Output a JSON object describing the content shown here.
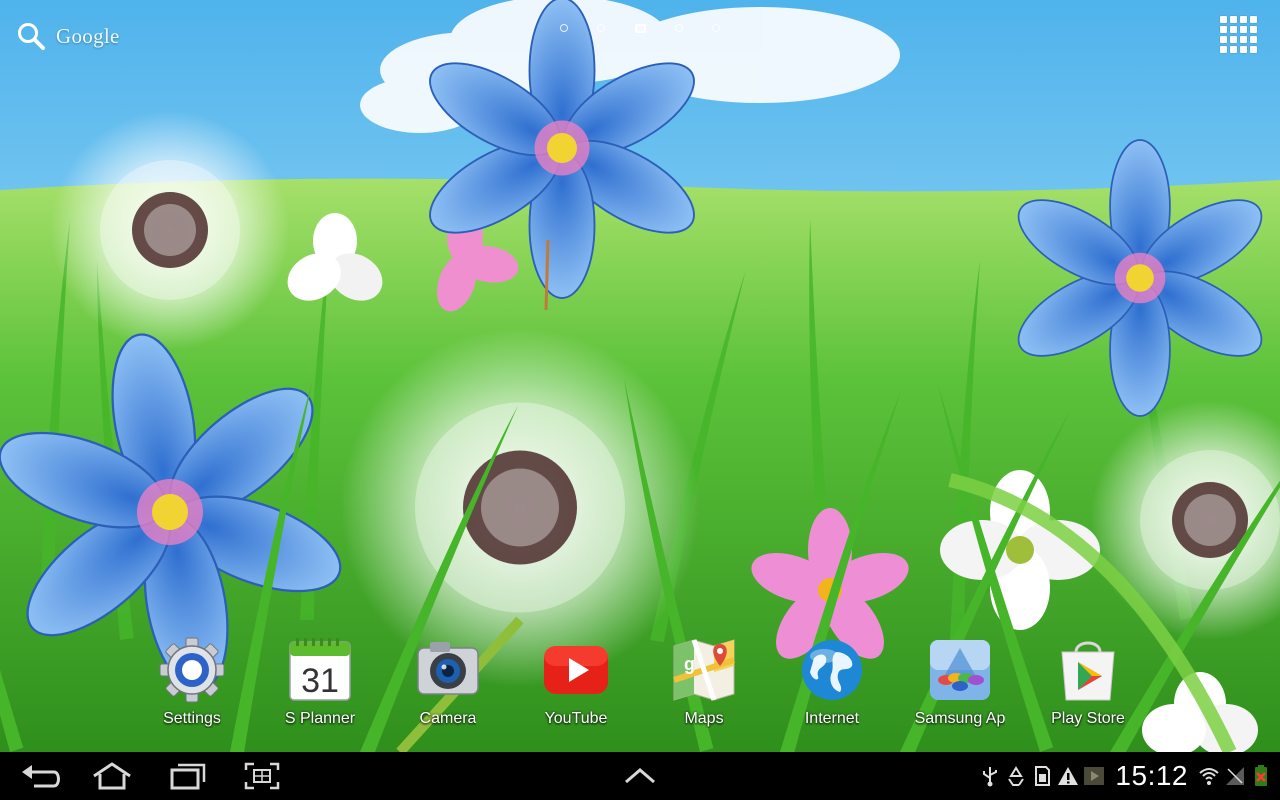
{
  "search": {
    "label": "Google",
    "icon": "search-icon"
  },
  "pager": {
    "count": 5,
    "active_index": 2
  },
  "apps_button": {
    "icon": "apps-grid-icon"
  },
  "dock": [
    {
      "label": "Settings",
      "icon": "settings-gear-icon"
    },
    {
      "label": "S Planner",
      "icon": "calendar-icon",
      "day": "31"
    },
    {
      "label": "Camera",
      "icon": "camera-icon"
    },
    {
      "label": "YouTube",
      "icon": "youtube-icon"
    },
    {
      "label": "Maps",
      "icon": "maps-icon"
    },
    {
      "label": "Internet",
      "icon": "globe-icon"
    },
    {
      "label": "Samsung Ap",
      "icon": "samsung-apps-icon"
    },
    {
      "label": "Play Store",
      "icon": "play-store-icon"
    }
  ],
  "navigation": {
    "back": "back-icon",
    "home": "home-icon",
    "recents": "recent-apps-icon",
    "screenshot": "screen-capture-icon",
    "up": "chevron-up-icon"
  },
  "status": {
    "time": "15:12",
    "icons": [
      "usb-icon",
      "recycle-icon",
      "sd-card-icon",
      "warning-icon",
      "media-icon",
      "wifi-icon",
      "signal-icon",
      "battery-icon"
    ]
  },
  "colors": {
    "sky": "#6fc6ee",
    "grass": "#5cc23a",
    "flower_blue": "#5a9ae6",
    "system_bar": "#000000"
  }
}
